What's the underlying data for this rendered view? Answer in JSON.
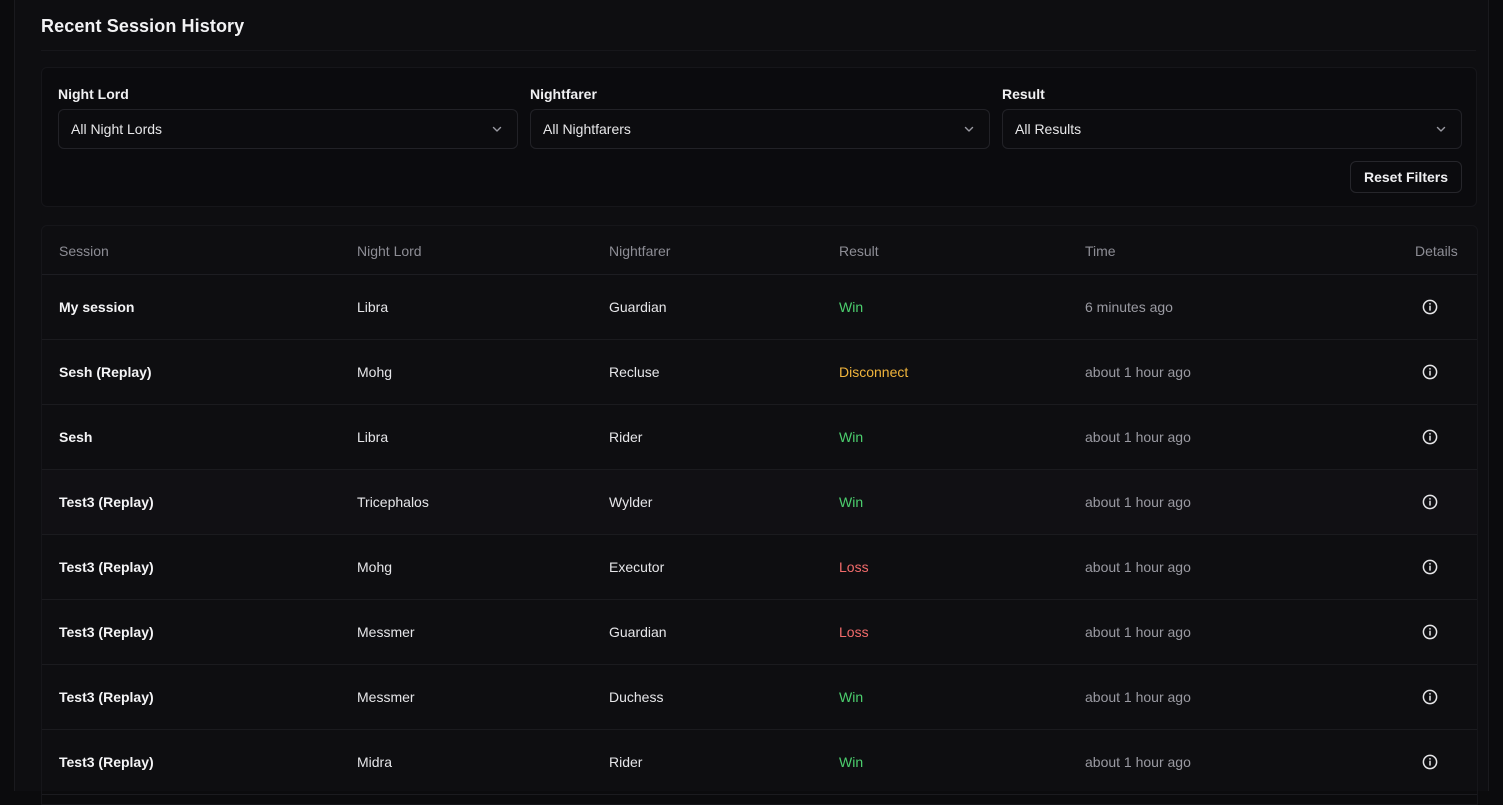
{
  "page": {
    "title": "Recent Session History"
  },
  "filters": {
    "night_lord": {
      "label": "Night Lord",
      "value": "All Night Lords"
    },
    "nightfarer": {
      "label": "Nightfarer",
      "value": "All Nightfarers"
    },
    "result": {
      "label": "Result",
      "value": "All Results"
    },
    "reset_label": "Reset Filters"
  },
  "table": {
    "headers": {
      "session": "Session",
      "night_lord": "Night Lord",
      "nightfarer": "Nightfarer",
      "result": "Result",
      "time": "Time",
      "details": "Details"
    },
    "rows": [
      {
        "session": "My session",
        "night_lord": "Libra",
        "nightfarer": "Guardian",
        "result": "Win",
        "time": "6 minutes ago"
      },
      {
        "session": "Sesh (Replay)",
        "night_lord": "Mohg",
        "nightfarer": "Recluse",
        "result": "Disconnect",
        "time": "about 1 hour ago"
      },
      {
        "session": "Sesh",
        "night_lord": "Libra",
        "nightfarer": "Rider",
        "result": "Win",
        "time": "about 1 hour ago"
      },
      {
        "session": "Test3 (Replay)",
        "night_lord": "Tricephalos",
        "nightfarer": "Wylder",
        "result": "Win",
        "time": "about 1 hour ago"
      },
      {
        "session": "Test3 (Replay)",
        "night_lord": "Mohg",
        "nightfarer": "Executor",
        "result": "Loss",
        "time": "about 1 hour ago"
      },
      {
        "session": "Test3 (Replay)",
        "night_lord": "Messmer",
        "nightfarer": "Guardian",
        "result": "Loss",
        "time": "about 1 hour ago"
      },
      {
        "session": "Test3 (Replay)",
        "night_lord": "Messmer",
        "nightfarer": "Duchess",
        "result": "Win",
        "time": "about 1 hour ago"
      },
      {
        "session": "Test3 (Replay)",
        "night_lord": "Midra",
        "nightfarer": "Rider",
        "result": "Win",
        "time": "about 1 hour ago"
      }
    ],
    "details_icon": "info-icon"
  },
  "colors": {
    "win": "#4ccf6e",
    "loss": "#f26b6b",
    "disconnect": "#f0b43c",
    "background": "#0e0e11"
  }
}
